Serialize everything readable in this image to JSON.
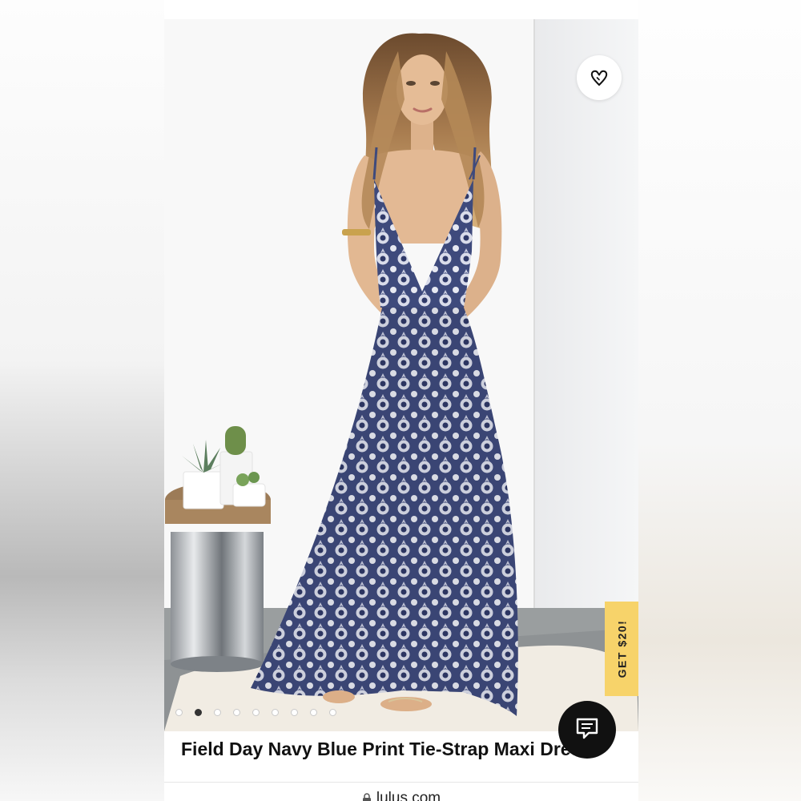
{
  "product": {
    "title": "Field Day Navy Blue Print Tie-Strap Maxi Dress"
  },
  "promo": {
    "label": "GET $20!"
  },
  "gallery": {
    "image_count": 9,
    "active_index": 1
  },
  "browser": {
    "url": "lulus.com"
  },
  "icons": {
    "favorite": "heart-icon",
    "chat": "chat-bubble-icon",
    "lock": "lock-icon"
  },
  "colors": {
    "promo_bg": "#f7d36a",
    "chat_bg": "#111111",
    "dress_navy": "#3e4a7c"
  }
}
